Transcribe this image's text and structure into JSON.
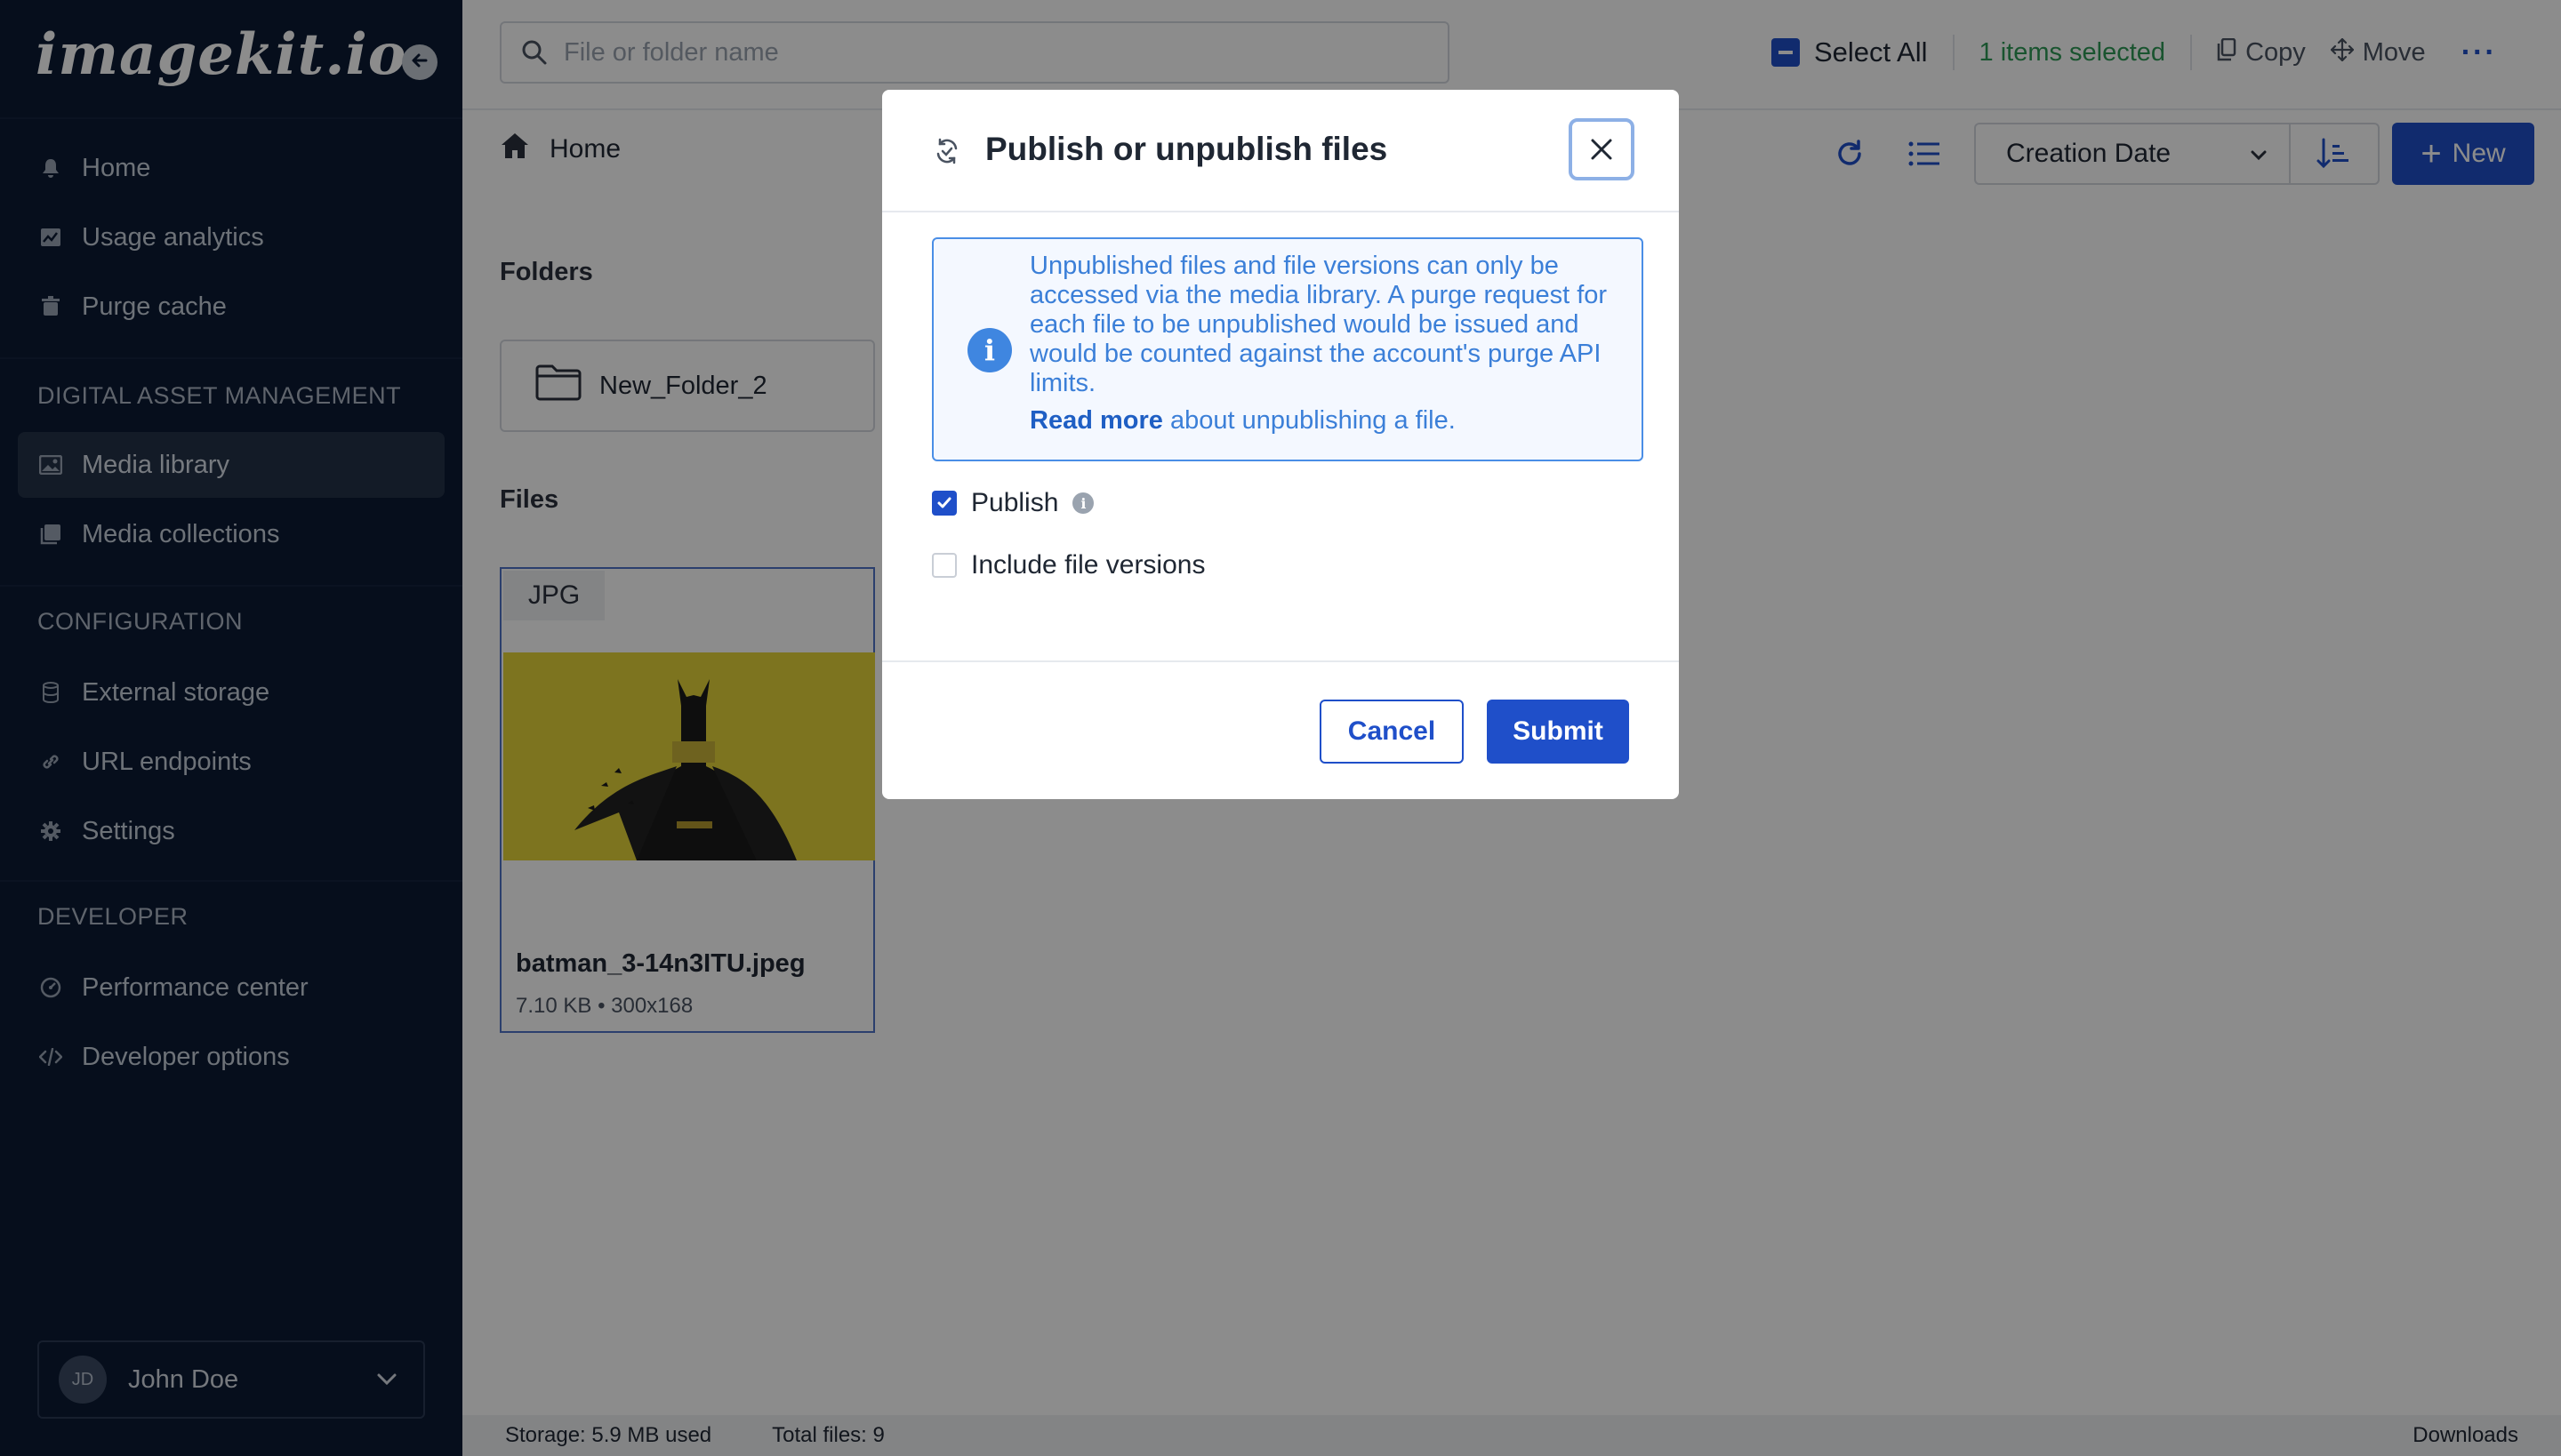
{
  "sidebar": {
    "logo": "imagekit.io",
    "primary_items": [
      {
        "label": "Home",
        "icon": "bell-icon"
      },
      {
        "label": "Usage analytics",
        "icon": "chart-icon"
      },
      {
        "label": "Purge cache",
        "icon": "trash-icon"
      }
    ],
    "dam_section_title": "DIGITAL ASSET MANAGEMENT",
    "dam_items": [
      {
        "label": "Media library",
        "icon": "image-icon",
        "active": true
      },
      {
        "label": "Media collections",
        "icon": "collection-icon"
      }
    ],
    "config_section_title": "CONFIGURATION",
    "config_items": [
      {
        "label": "External storage",
        "icon": "database-icon"
      },
      {
        "label": "URL endpoints",
        "icon": "link-icon"
      },
      {
        "label": "Settings",
        "icon": "gear-icon"
      }
    ],
    "dev_section_title": "DEVELOPER",
    "dev_items": [
      {
        "label": "Performance center",
        "icon": "gauge-icon"
      },
      {
        "label": "Developer options",
        "icon": "code-icon"
      }
    ],
    "user": {
      "initials": "JD",
      "name": "John Doe"
    }
  },
  "topbar": {
    "search_placeholder": "File or folder name",
    "select_all_label": "Select All",
    "selected_count": "1 items selected",
    "copy_label": "Copy",
    "move_label": "Move",
    "more_label": "···"
  },
  "toolbar": {
    "breadcrumb_home": "Home",
    "sort_label": "Creation Date",
    "new_label": "New"
  },
  "content": {
    "folders_label": "Folders",
    "folders": [
      {
        "name": "New_Folder_2"
      }
    ],
    "files_label": "Files",
    "files": [
      {
        "badge": "JPG",
        "name": "batman_3-14n3ITU.jpeg",
        "meta": "7.10 KB • 300x168"
      }
    ]
  },
  "statusbar": {
    "storage": "Storage: 5.9 MB used",
    "total_files": "Total files: 9",
    "downloads": "Downloads"
  },
  "modal": {
    "title": "Publish or unpublish files",
    "info_text": "Unpublished files and file versions can only be accessed via the media library. A purge request for each file to be unpublished would be issued and would be counted against the account's purge API limits.",
    "read_more": "Read more",
    "read_more_suffix": " about unpublishing a file.",
    "publish_label": "Publish",
    "publish_checked": true,
    "include_versions_label": "Include file versions",
    "include_versions_checked": false,
    "cancel_label": "Cancel",
    "submit_label": "Submit"
  },
  "colors": {
    "sidebar_bg": "#0b1a33",
    "accent": "#1f4fc9",
    "success": "#2e9a56",
    "info": "#3b7fd8"
  }
}
